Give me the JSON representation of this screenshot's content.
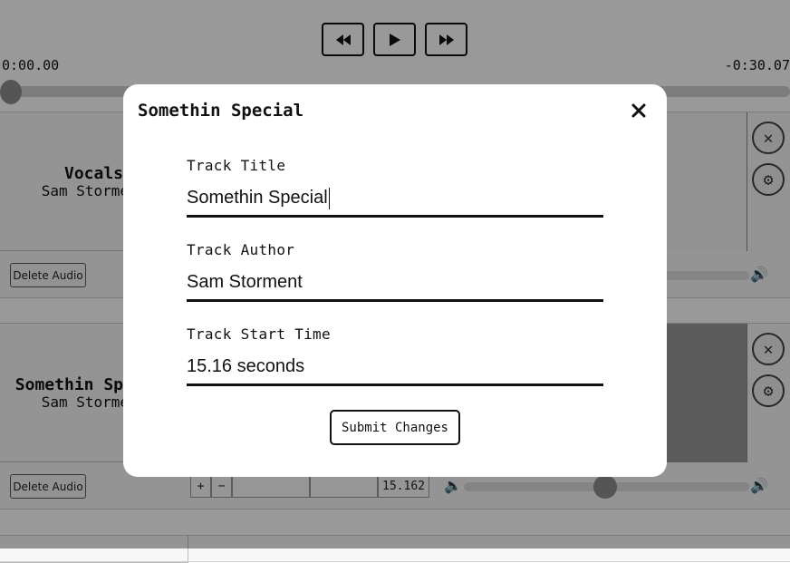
{
  "player": {
    "time_elapsed": "0:00.00",
    "time_remaining": "-0:30.07",
    "rewind_icon": "rewind-icon",
    "play_icon": "play-icon",
    "forward_icon": "fast-forward-icon"
  },
  "tracks": [
    {
      "title": "Vocals",
      "author": "Sam Storment",
      "delete_label": "Delete Audio"
    },
    {
      "title": "Somethin Special",
      "author": "Sam Storment",
      "delete_label": "Delete Audio",
      "start_time_value": "15.162"
    }
  ],
  "modal": {
    "title": "Somethin Special",
    "close_icon": "close-icon",
    "fields": [
      {
        "label": "Track Title",
        "value": "Somethin Special"
      },
      {
        "label": "Track Author",
        "value": "Sam Storment"
      },
      {
        "label": "Track Start Time",
        "value": "15.16 seconds"
      }
    ],
    "submit_label": "Submit Changes"
  }
}
